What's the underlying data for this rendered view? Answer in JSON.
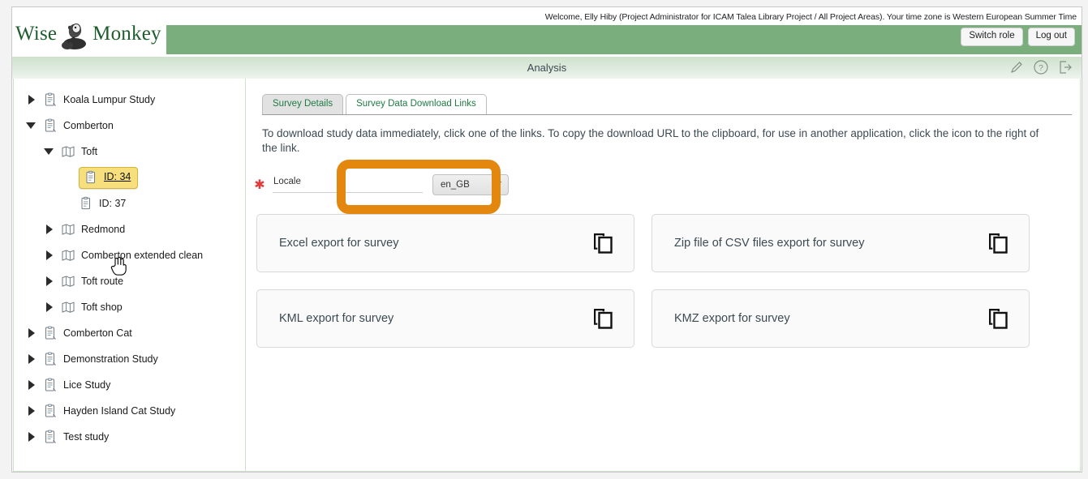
{
  "brand": {
    "name_part1": "Wise",
    "name_part2": "Monkey",
    "logo_icon": "monkey-logo-icon"
  },
  "header": {
    "welcome_text": "Welcome, Elly Hiby (Project Administrator for ICAM Talea Library Project / All Project Areas). Your time zone is Western European Summer Time",
    "switch_role_label": "Switch role",
    "log_out_label": "Log out",
    "bar_color": "#7bae7d"
  },
  "titlebar": {
    "title": "Analysis",
    "icons": [
      "pencil-icon",
      "help-icon",
      "exit-icon"
    ]
  },
  "sidebar": {
    "items": [
      {
        "label": "Koala Lumpur Study",
        "icon": "study-icon",
        "twisty": "closed",
        "indent": 0
      },
      {
        "label": "Comberton",
        "icon": "study-icon",
        "twisty": "open",
        "indent": 0
      },
      {
        "label": "Toft",
        "icon": "survey-area-icon",
        "twisty": "open",
        "indent": 1
      },
      {
        "label": "ID: 34",
        "icon": "survey-icon",
        "twisty": "empty",
        "indent": 2,
        "selected": true,
        "link": true
      },
      {
        "label": "ID: 37",
        "icon": "survey-icon",
        "twisty": "empty",
        "indent": 2
      },
      {
        "label": "Redmond",
        "icon": "survey-area-icon",
        "twisty": "closed",
        "indent": 1
      },
      {
        "label": "Comberton extended clean",
        "icon": "survey-area-icon",
        "twisty": "closed",
        "indent": 1
      },
      {
        "label": "Toft route",
        "icon": "survey-area-icon",
        "twisty": "closed",
        "indent": 1
      },
      {
        "label": "Toft shop",
        "icon": "survey-area-icon",
        "twisty": "closed",
        "indent": 1
      },
      {
        "label": "Comberton Cat",
        "icon": "study-icon",
        "twisty": "closed",
        "indent": 0
      },
      {
        "label": "Demonstration Study",
        "icon": "study-icon",
        "twisty": "closed",
        "indent": 0
      },
      {
        "label": "Lice Study",
        "icon": "study-icon",
        "twisty": "closed",
        "indent": 0
      },
      {
        "label": "Hayden Island Cat Study",
        "icon": "study-icon",
        "twisty": "closed",
        "indent": 0
      },
      {
        "label": "Test study",
        "icon": "study-icon",
        "twisty": "closed",
        "indent": 0
      }
    ],
    "highlight_color": "#f7df7d"
  },
  "main": {
    "tabs": [
      {
        "label": "Survey Details",
        "active": false
      },
      {
        "label": "Survey Data Download Links",
        "active": true
      }
    ],
    "instructions": "To download study data immediately, click one of the links. To copy the download URL to the clipboard, for use in another application, click the icon to the right of the link.",
    "locale": {
      "required_marker": "✱",
      "label": "Locale",
      "value": "en_GB"
    },
    "download_cards": [
      {
        "label": "Excel export for survey",
        "copy_icon": "copy-icon"
      },
      {
        "label": "Zip file of CSV files export for survey",
        "copy_icon": "copy-icon"
      },
      {
        "label": "KML export for survey",
        "copy_icon": "copy-icon"
      },
      {
        "label": "KMZ export for survey",
        "copy_icon": "copy-icon"
      }
    ]
  },
  "annotation": {
    "shape": "rounded-rectangle-highlight",
    "color": "#e4870f",
    "target": "Survey Data Download Links"
  }
}
